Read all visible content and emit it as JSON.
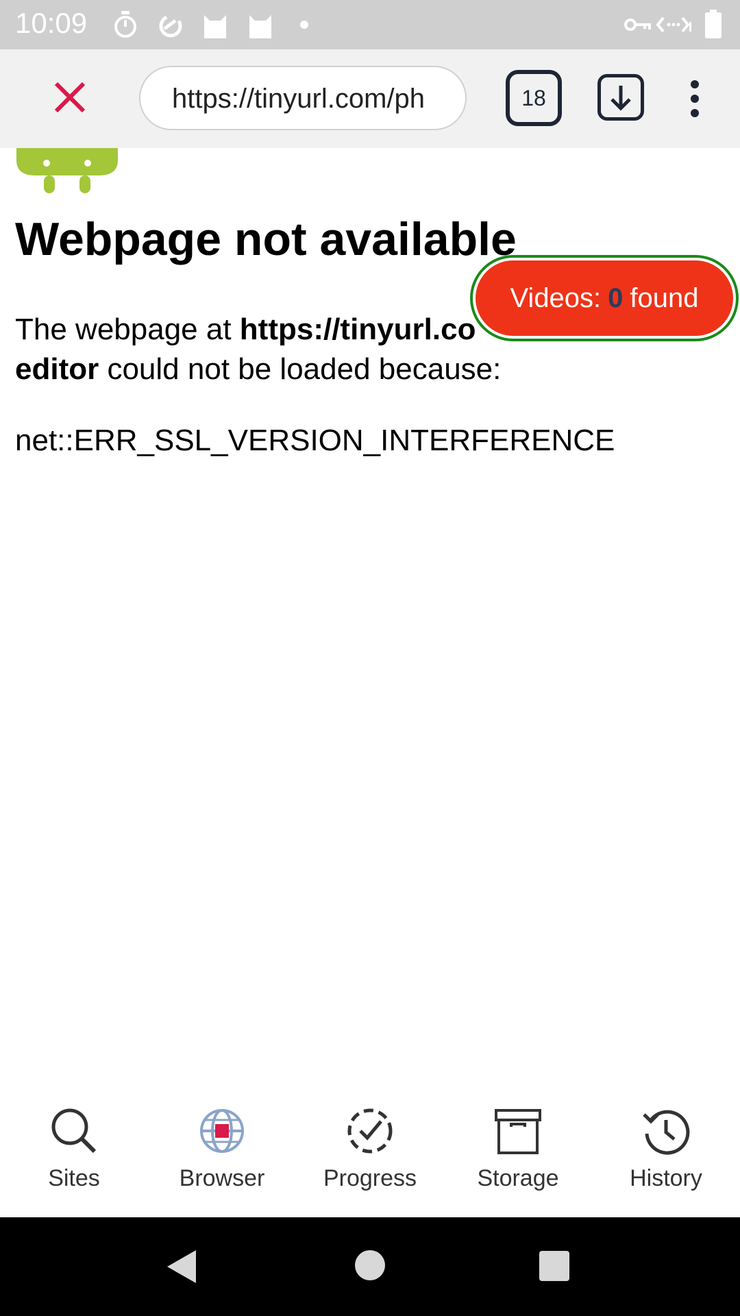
{
  "status_bar": {
    "time": "10:09",
    "icons_left": [
      "timer-icon",
      "data-saver-icon",
      "cat-icon",
      "cat-icon",
      "dot-icon"
    ],
    "icons_right": [
      "vpn-key-icon",
      "data-transfer-icon",
      "battery-icon"
    ]
  },
  "toolbar": {
    "url": "https://tinyurl.com/ph",
    "tab_count": "18",
    "close_icon": "close-icon",
    "download_icon": "download-icon",
    "menu_icon": "more-vert-icon"
  },
  "page": {
    "heading": "Webpage not available",
    "body_prefix": "The webpage at ",
    "body_url": "https://tinyurl.co",
    "body_url_line2": "editor",
    "body_suffix": " could not be loaded because:",
    "error_code": "net::ERR_SSL_VERSION_INTERFERENCE"
  },
  "videos_badge": {
    "prefix": "Videos:",
    "count": "0",
    "suffix": "found"
  },
  "bottom_nav": {
    "items": [
      {
        "label": "Sites",
        "icon": "search-icon"
      },
      {
        "label": "Browser",
        "icon": "globe-icon"
      },
      {
        "label": "Progress",
        "icon": "progress-check-icon"
      },
      {
        "label": "Storage",
        "icon": "archive-box-icon"
      },
      {
        "label": "History",
        "icon": "history-icon"
      }
    ]
  },
  "colors": {
    "accent_close": "#d81b4a",
    "badge_red": "#ee3318",
    "badge_border": "#1a8a1a",
    "android_green": "#a4c639"
  }
}
